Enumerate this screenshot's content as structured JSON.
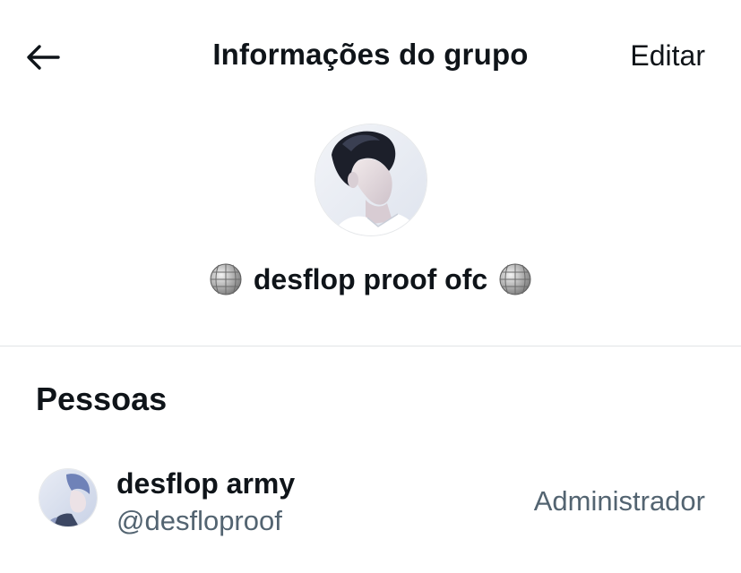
{
  "header": {
    "title": "Informações do grupo",
    "edit_label": "Editar",
    "back_icon": "arrow-left-icon"
  },
  "group": {
    "name": "desflop proof ofc",
    "name_emoji": "mirror-ball"
  },
  "people": {
    "section_title": "Pessoas",
    "members": [
      {
        "display_name": "desflop army",
        "handle": "@desfloproof",
        "role": "Administrador"
      }
    ]
  },
  "colors": {
    "text_primary": "#0f1419",
    "text_secondary": "#536471",
    "divider": "#e1e4e6",
    "background": "#ffffff"
  }
}
